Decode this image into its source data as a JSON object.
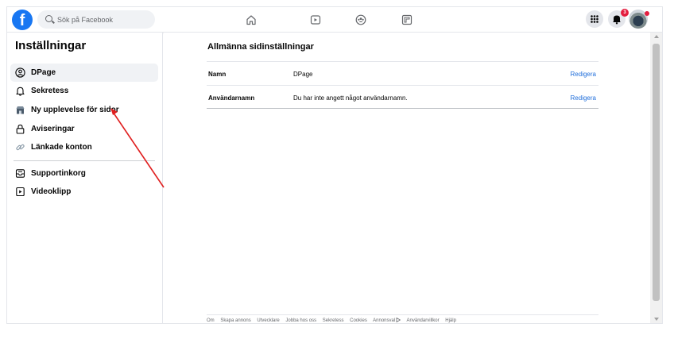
{
  "topbar": {
    "logo_letter": "f",
    "search_placeholder": "Sök på Facebook",
    "notification_count": "3",
    "nav": [
      "home-icon",
      "video-icon",
      "groups-icon",
      "gaming-icon"
    ]
  },
  "sidebar": {
    "title": "Inställningar",
    "items": [
      {
        "label": "DPage",
        "icon": "page-profile-icon"
      },
      {
        "label": "Sekretess",
        "icon": "bell-icon"
      },
      {
        "label": "Ny upplevelse för sidor",
        "icon": "new-pages-icon"
      },
      {
        "label": "Aviseringar",
        "icon": "lock-icon"
      },
      {
        "label": "Länkade konton",
        "icon": "link-icon"
      },
      {
        "label": "Supportinkorg",
        "icon": "inbox-icon"
      },
      {
        "label": "Videoklipp",
        "icon": "video-clip-icon"
      }
    ]
  },
  "main": {
    "title": "Allmänna sidinställningar",
    "rows": [
      {
        "key": "Namn",
        "value": "DPage",
        "action": "Redigera"
      },
      {
        "key": "Användarnamn",
        "value": "Du har inte angett något användarnamn.",
        "action": "Redigera"
      }
    ]
  },
  "footer": {
    "links": [
      "Om",
      "Skapa annons",
      "Utvecklare",
      "Jobba hos oss",
      "Sekretess",
      "Cookies",
      "Annonsval",
      "Användarvillkor",
      "Hjälp"
    ]
  },
  "colors": {
    "brand": "#1877f2",
    "link": "#216fdb",
    "annotation": "#e02020",
    "badge": "#e41e3f"
  }
}
